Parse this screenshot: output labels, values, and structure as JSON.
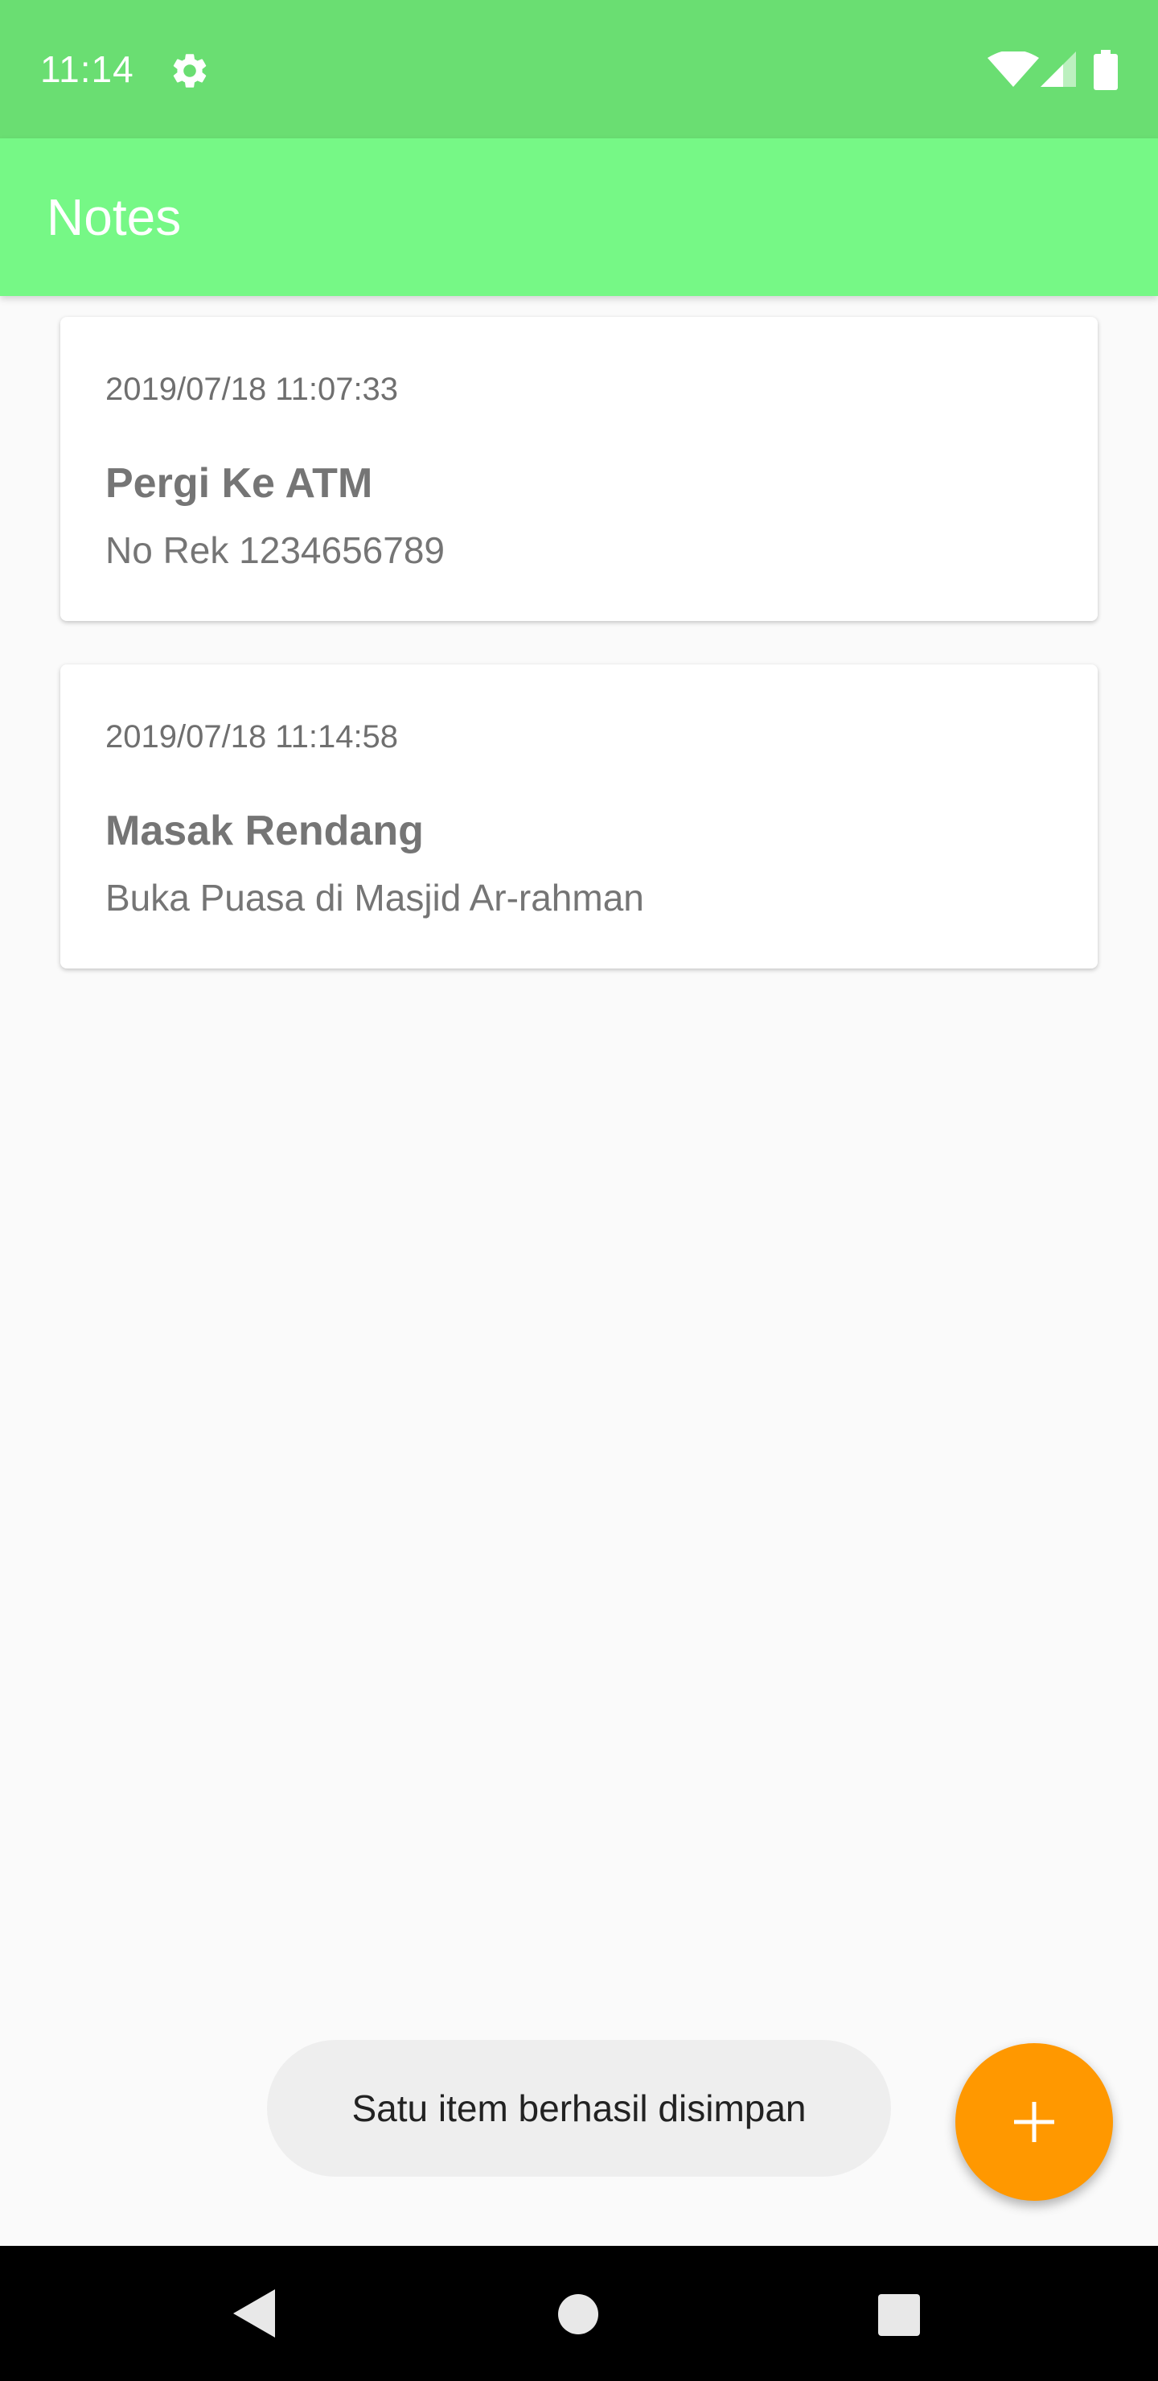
{
  "status_bar": {
    "time": "11:14",
    "icons": [
      "settings-gear-icon",
      "wifi-icon",
      "cell-signal-icon",
      "battery-icon"
    ]
  },
  "app_bar": {
    "title": "Notes",
    "color": "#76f886"
  },
  "notes": [
    {
      "date": "2019/07/18 11:07:33",
      "title": "Pergi Ke ATM",
      "description": "No Rek 1234656789"
    },
    {
      "date": "2019/07/18 11:14:58",
      "title": "Masak Rendang",
      "description": "Buka Puasa di Masjid Ar-rahman"
    }
  ],
  "toast": {
    "message": "Satu item berhasil disimpan"
  },
  "fab": {
    "icon": "plus-icon",
    "color": "#ff9800"
  },
  "nav_bar": {
    "icons": [
      "back-icon",
      "home-icon",
      "recents-icon"
    ]
  }
}
